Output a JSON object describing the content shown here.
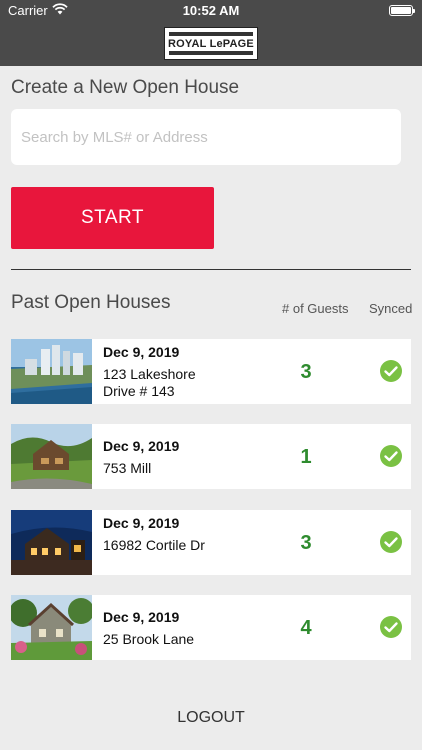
{
  "status_bar": {
    "carrier": "Carrier",
    "time": "10:52 AM",
    "wifi_icon": "wifi-icon",
    "battery_icon": "battery-icon"
  },
  "header": {
    "logo_text": "ROYAL LePAGE"
  },
  "create": {
    "title": "Create a New Open House",
    "search_placeholder": "Search by MLS# or Address",
    "search_value": "",
    "start_label": "START",
    "start_color": "#e8163c"
  },
  "past": {
    "title": "Past Open Houses",
    "guests_header": "# of Guests",
    "synced_header": "Synced",
    "synced_color": "#7ac143",
    "guests_color": "#2e8b2e",
    "rows": [
      {
        "date": "Dec 9, 2019",
        "address": "123 Lakeshore Drive # 143",
        "guests": "3",
        "synced": true
      },
      {
        "date": "Dec 9, 2019",
        "address": "753 Mill",
        "guests": "1",
        "synced": true
      },
      {
        "date": "Dec 9, 2019",
        "address": "16982 Cortile Dr",
        "guests": "3",
        "synced": true
      },
      {
        "date": "Dec 9, 2019",
        "address": "25 Brook Lane",
        "guests": "4",
        "synced": true
      }
    ]
  },
  "footer": {
    "logout_label": "LOGOUT"
  }
}
